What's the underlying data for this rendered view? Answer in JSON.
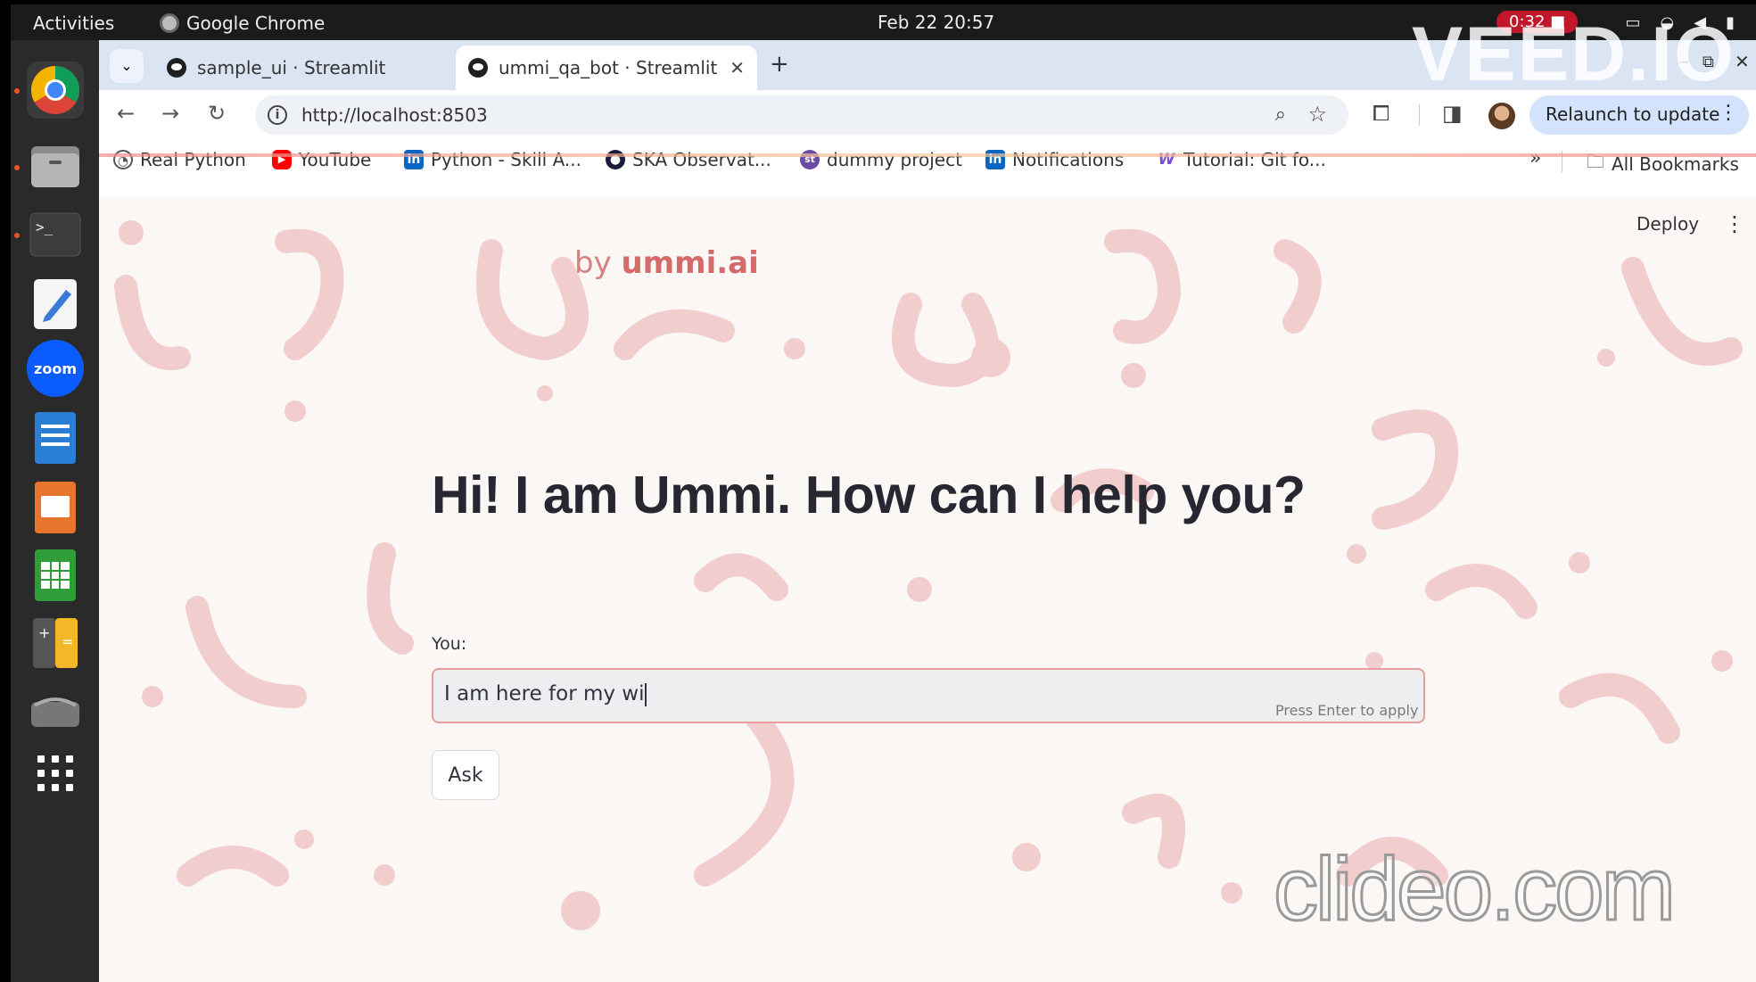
{
  "topbar": {
    "activities": "Activities",
    "app_name": "Google Chrome",
    "clock": "Feb 22  20:57",
    "recording_time": "0:32"
  },
  "dock": {
    "items": [
      "chrome-icon",
      "files-icon",
      "terminal-icon",
      "text-editor-icon",
      "zoom-icon",
      "writer-icon",
      "impress-icon",
      "calc-icon",
      "calculator-icon",
      "scanner-icon",
      "app-grid-icon"
    ],
    "zoom_label": "zoom"
  },
  "tabs": [
    {
      "title": "sample_ui · Streamlit",
      "active": false
    },
    {
      "title": "ummi_qa_bot · Streamlit",
      "active": true
    }
  ],
  "toolbar": {
    "url": "http://localhost:8503",
    "relaunch_label": "Relaunch to update"
  },
  "bookmarks": {
    "items": [
      {
        "label": "Real Python",
        "color": "#555555",
        "icon": "real-python-icon"
      },
      {
        "label": "YouTube",
        "color": "#ff0000",
        "icon": "youtube-icon"
      },
      {
        "label": "Python - Skill A...",
        "color": "#0a66c2",
        "icon": "linkedin-icon"
      },
      {
        "label": "SKA Observat...",
        "color": "#1a1a3a",
        "icon": "ska-icon"
      },
      {
        "label": "dummy project",
        "color": "#6b4ba3",
        "icon": "project-icon"
      },
      {
        "label": "Notifications",
        "color": "#0a66c2",
        "icon": "linkedin-icon"
      },
      {
        "label": "Tutorial: Git fo...",
        "color": "#7a4fd6",
        "icon": "w-icon"
      }
    ],
    "all_bookmarks": "All Bookmarks"
  },
  "page": {
    "deploy_label": "Deploy",
    "logo_prefix": "by",
    "logo_brand": "ummi.ai",
    "headline": "Hi! I am Ummi. How can I help you?",
    "input_label": "You:",
    "input_value": "I am here for my wi",
    "input_hint": "Press Enter to apply",
    "ask_label": "Ask"
  },
  "watermarks": {
    "top": "VEED.IO",
    "bottom": "clideo.com"
  },
  "colors": {
    "accent": "#ea9b9b",
    "relaunch_bg": "#d3e3fd",
    "tabstrip_bg": "#dbe4f3"
  }
}
